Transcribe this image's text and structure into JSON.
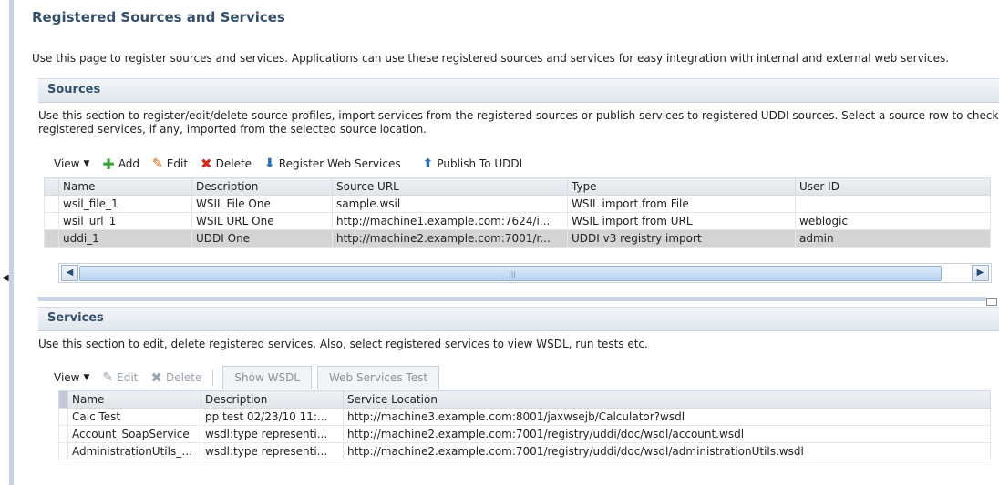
{
  "page": {
    "title": "Registered Sources and Services",
    "description": "Use this page to register sources and services. Applications can use these registered sources and services for easy integration with internal and external web services."
  },
  "sources": {
    "header": "Sources",
    "description_line1": "Use this section to register/edit/delete source profiles, import services from the registered sources or publish services to registered UDDI sources. Select a source row to check ou",
    "description_line2": "registered services, if any, imported from the selected source location.",
    "toolbar": {
      "view": "View",
      "add": "Add",
      "edit": "Edit",
      "delete": "Delete",
      "register": "Register Web Services",
      "publish": "Publish To UDDI"
    },
    "columns": [
      "Name",
      "Description",
      "Source URL",
      "Type",
      "User ID"
    ],
    "rows": [
      {
        "name": "wsil_file_1",
        "description": "WSIL File One",
        "url": "sample.wsil",
        "type": "WSIL import from File",
        "user": ""
      },
      {
        "name": "wsil_url_1",
        "description": "WSIL URL One",
        "url": "http://machine1.example.com:7624/i...",
        "type": "WSIL import from URL",
        "user": "weblogic"
      },
      {
        "name": "uddi_1",
        "description": "UDDI One",
        "url": "http://machine2.example.com:7001/r...",
        "type": "UDDI v3 registry import",
        "user": "admin"
      }
    ],
    "selected_row": 2
  },
  "services": {
    "header": "Services",
    "description": "Use this section to edit, delete registered services. Also, select registered services to view WSDL, run tests etc.",
    "toolbar": {
      "view": "View",
      "edit": "Edit",
      "delete": "Delete",
      "show_wsdl": "Show WSDL",
      "ws_test": "Web Services Test"
    },
    "columns": [
      "Name",
      "Description",
      "Service Location"
    ],
    "rows": [
      {
        "name": "Calc Test",
        "description": "pp test 02/23/10 11:...",
        "location": "http://machine3.example.com:8001/jaxwsejb/Calculator?wsdl"
      },
      {
        "name": "Account_SoapService",
        "description": "wsdl:type representi...",
        "location": "http://machine2.example.com:7001/registry/uddi/doc/wsdl/account.wsdl"
      },
      {
        "name": "AdministrationUtils_S...",
        "description": "wsdl:type representi...",
        "location": "http://machine2.example.com:7001/registry/uddi/doc/wsdl/administrationUtils.wsdl"
      }
    ]
  },
  "colors": {
    "title": "#35506b",
    "add_icon": "#3aa33a",
    "edit_icon": "#e06a10",
    "delete_icon": "#d42a1a",
    "selected_row": "#d4d4d4"
  }
}
